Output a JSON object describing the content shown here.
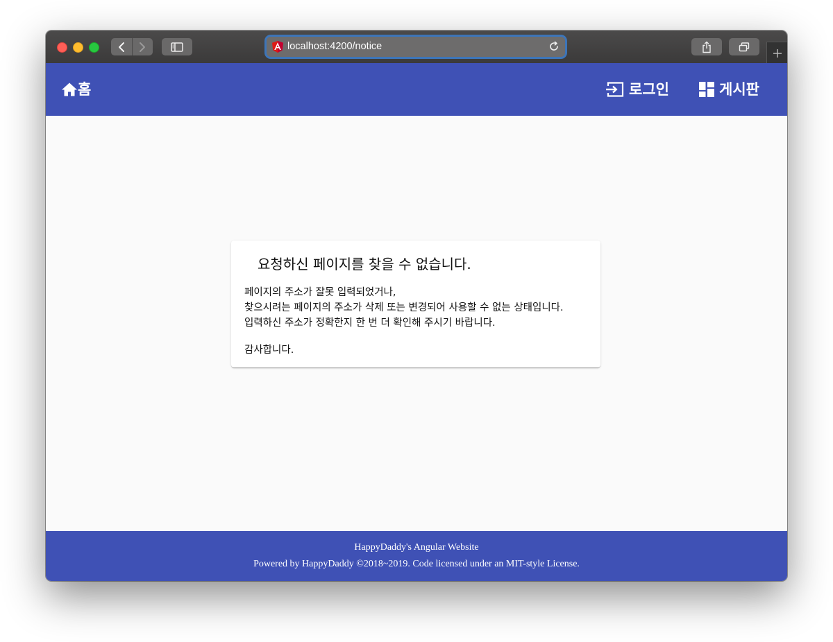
{
  "browser": {
    "url": "localhost:4200/notice",
    "buttons": {
      "back_icon": "chevron-left-icon",
      "forward_icon": "chevron-right-icon",
      "sidebar_icon": "sidebar-icon",
      "reload_icon": "reload-icon",
      "share_icon": "share-icon",
      "tabs_icon": "tabs-overview-icon",
      "new_tab_icon": "plus-icon"
    },
    "colors": {
      "close": "#ff5f57",
      "minimize": "#febc2e",
      "maximize": "#28c840",
      "focus_ring": "#3d75b8",
      "favicon": "#dd1b16"
    }
  },
  "toolbar": {
    "home_label": "홈",
    "login_label": "로그인",
    "board_label": "게시판",
    "color": "#3f51b5"
  },
  "notice": {
    "title": "요청하신 페이지를 찾을 수 없습니다.",
    "lines": [
      "페이지의 주소가 잘못 입력되었거나,",
      "찾으시려는 페이지의 주소가 삭제 또는 변경되어 사용할 수 없는 상태입니다.",
      "입력하신 주소가 정확한지 한 번 더 확인해 주시기 바랍니다."
    ],
    "closing": "감사합니다."
  },
  "footer": {
    "site_name": "HappyDaddy's Angular Website",
    "credits": "Powered by HappyDaddy ©2018~2019. Code licensed under an MIT-style License."
  }
}
